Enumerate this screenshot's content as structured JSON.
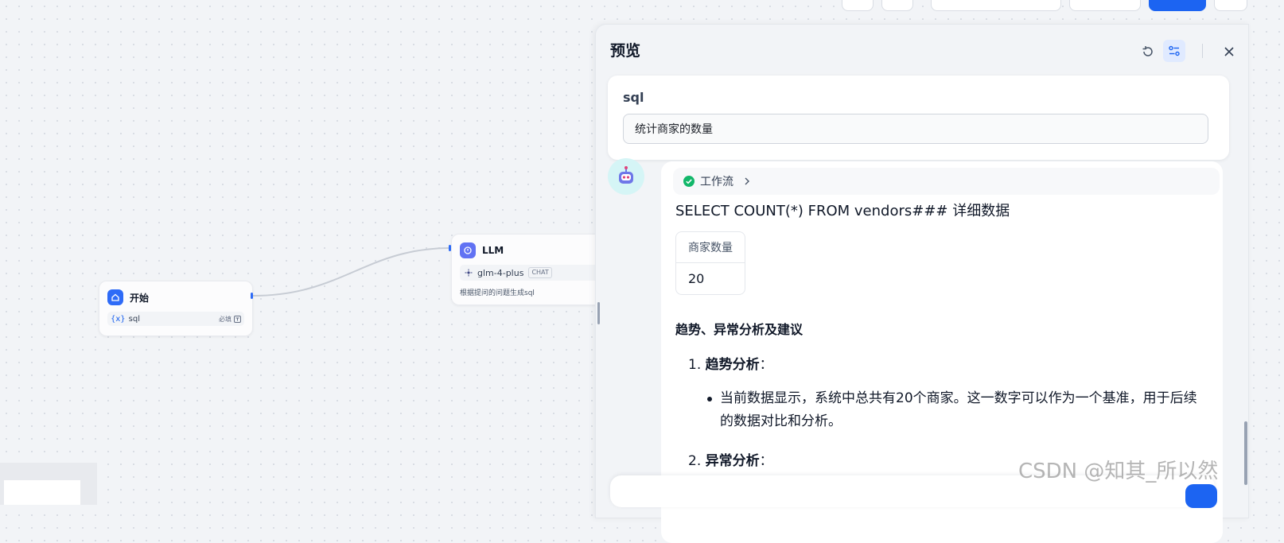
{
  "workflow": {
    "start_node": {
      "title": "开始",
      "variable": "sql",
      "variable_prefix": "{x}",
      "required_label": "必填"
    },
    "llm_node": {
      "title": "LLM",
      "model": "glm-4-plus",
      "model_tag": "CHAT",
      "description": "根据提问的问题生成sql"
    }
  },
  "preview": {
    "title": "预览",
    "variable_label": "sql",
    "variable_value": "统计商家的数量",
    "workflow_chip_label": "工作流",
    "answer": {
      "sql_text": "SELECT COUNT(*) FROM vendors### 详细数据",
      "table": {
        "headers": [
          "商家数量"
        ],
        "rows": [
          [
            "20"
          ]
        ]
      },
      "section_heading": "趋势、异常分析及建议",
      "list": [
        {
          "number": "1.",
          "title": "趋势分析",
          "suffix": "："
        },
        {
          "number": "2.",
          "title": "异常分析",
          "suffix": "："
        }
      ],
      "bullet_text": "当前数据显示，系统中总共有20个商家。这一数字可以作为一个基准，用于后续的数据对比和分析。"
    }
  },
  "watermark": "CSDN @知其_所以然",
  "colors": {
    "accent": "#1c64f2",
    "success": "#12b76a",
    "start_icon": "#2e6bf7",
    "llm_icon": "#6172f3"
  }
}
